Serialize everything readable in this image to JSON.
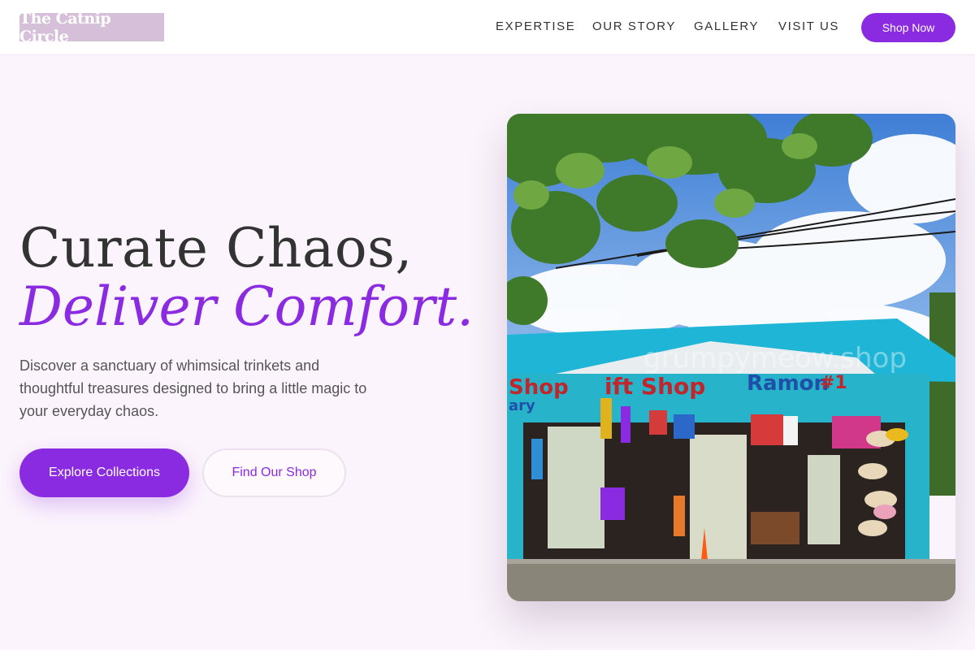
{
  "brand": {
    "logo_text": "The Catnip Circle"
  },
  "nav": {
    "links": [
      "EXPERTISE",
      "OUR STORY",
      "GALLERY",
      "VISIT US"
    ],
    "cta_label": "Shop Now"
  },
  "hero": {
    "headline_line1": "Curate Chaos,",
    "headline_line2": "Deliver Comfort.",
    "lead": "Discover a sanctuary of whimsical trinkets and thoughtful treasures designed to bring a little magic to your everyday chaos.",
    "primary_button": "Explore Collections",
    "secondary_button": "Find Our Shop"
  },
  "image": {
    "watermark": "grumpymeow.shop",
    "signs": [
      "Shop",
      "ary",
      "ift Shop",
      "Ramon",
      "#1"
    ]
  },
  "colors": {
    "accent": "#8a2be2",
    "background": "#fbf4fc",
    "logo_bg": "#d6bfd9"
  }
}
